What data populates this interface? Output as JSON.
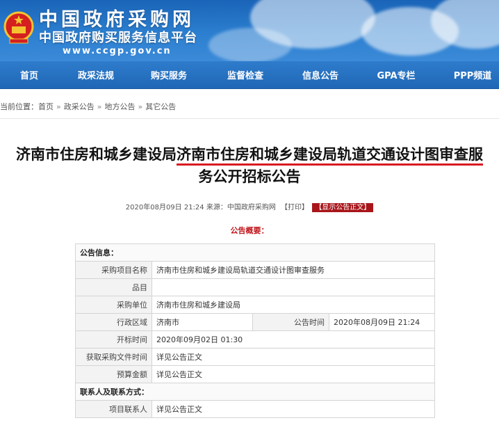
{
  "header": {
    "title": "中国政府采购网",
    "subtitle": "中国政府购买服务信息平台",
    "url": "www.ccgp.gov.cn"
  },
  "nav": {
    "items": [
      {
        "label": "首页"
      },
      {
        "label": "政采法规"
      },
      {
        "label": "购买服务"
      },
      {
        "label": "监督检查"
      },
      {
        "label": "信息公告"
      },
      {
        "label": "GPA专栏"
      },
      {
        "label": "PPP频道"
      }
    ]
  },
  "breadcrumb": {
    "prefix": "当前位置：",
    "items": [
      "首页",
      "政采公告",
      "地方公告",
      "其它公告"
    ],
    "separator": "»"
  },
  "article": {
    "title_part1": "济南市住房和城乡建设局",
    "title_part2": "济南市住房和城乡建设局轨道交通设计图审查服",
    "title_line2": "务公开招标公告",
    "meta_date": "2020年08月09日 21:24",
    "meta_source_label": "来源：",
    "meta_source": "中国政府采购网",
    "print_label": "【打印】",
    "show_body_label": "【显示公告正文】",
    "summary_title": "公告概要："
  },
  "table": {
    "section_info": "公告信息：",
    "project_name_label": "采购项目名称",
    "project_name": "济南市住房和城乡建设局轨道交通设计图审查服务",
    "item_label": "品目",
    "item": "",
    "buyer_label": "采购单位",
    "buyer": "济南市住房和城乡建设局",
    "region_label": "行政区域",
    "region": "济南市",
    "pub_time_label": "公告时间",
    "pub_time": "2020年08月09日  21:24",
    "open_time_label": "开标时间",
    "open_time": "2020年09月02日  01:30",
    "doc_time_label": "获取采购文件时间",
    "doc_time": "详见公告正文",
    "budget_label": "预算金额",
    "budget": "详见公告正文",
    "section_contact": "联系人及联系方式：",
    "contact_label": "项目联系人",
    "contact": "详见公告正文"
  },
  "colors": {
    "banner_blue": "#2c7fd0",
    "nav_blue": "#1f67b6",
    "accent_red": "#c0161b",
    "underline_red": "#d9191f"
  }
}
